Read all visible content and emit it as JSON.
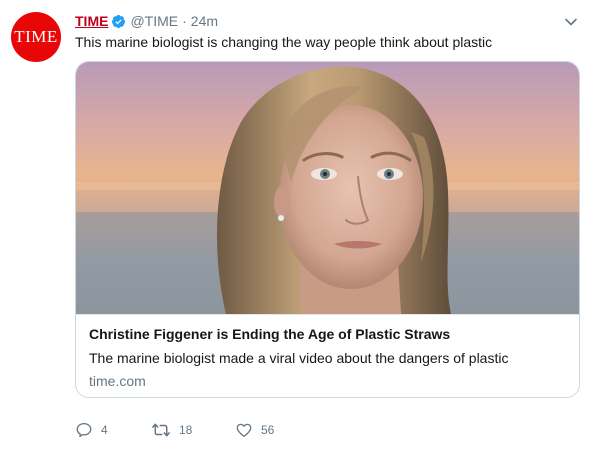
{
  "tweet": {
    "avatar_text": "TIME",
    "author_name": "TIME",
    "handle": "@TIME",
    "separator": "·",
    "timestamp": "24m",
    "text": "This marine biologist is changing the way people think about plastic"
  },
  "card": {
    "image_alt": "Portrait of a woman with long blonde hair at sunset by the water",
    "title": "Christine Figgener is Ending the Age of Plastic Straws",
    "description": "The marine biologist made a viral video about the dangers of plastic",
    "domain": "time.com"
  },
  "actions": {
    "reply_count": "4",
    "retweet_count": "18",
    "like_count": "56"
  },
  "colors": {
    "brand": "#e90606",
    "link": "#c0001e",
    "muted": "#657786",
    "verified": "#1da1f2",
    "border": "#ccd6dd"
  },
  "icons": [
    "time-avatar",
    "verified-badge-icon",
    "chevron-down-icon",
    "reply-icon",
    "retweet-icon",
    "like-icon"
  ]
}
